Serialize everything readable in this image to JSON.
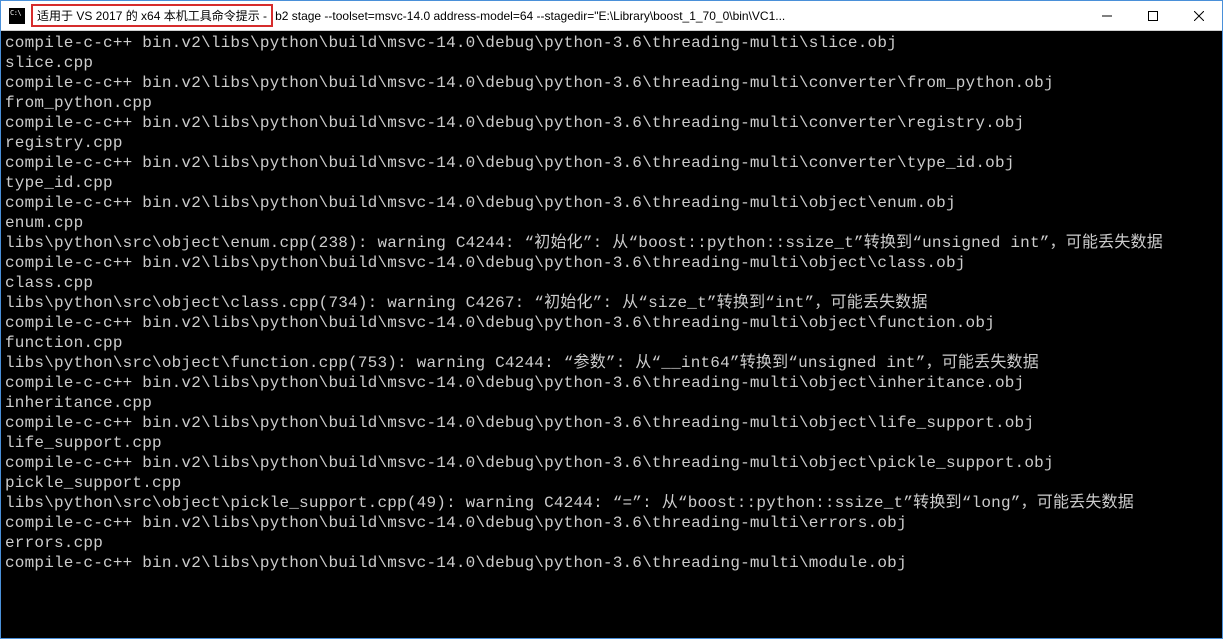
{
  "titlebar": {
    "highlighted": "适用于 VS 2017 的 x64 本机工具命令提示 -",
    "rest": " b2  stage --toolset=msvc-14.0 address-model=64 --stagedir=\"E:\\Library\\boost_1_70_0\\bin\\VC1..."
  },
  "controls": {
    "minimize": "minimize",
    "maximize": "maximize",
    "close": "close"
  },
  "console": {
    "lines": [
      "compile-c-c++ bin.v2\\libs\\python\\build\\msvc-14.0\\debug\\python-3.6\\threading-multi\\slice.obj",
      "slice.cpp",
      "compile-c-c++ bin.v2\\libs\\python\\build\\msvc-14.0\\debug\\python-3.6\\threading-multi\\converter\\from_python.obj",
      "from_python.cpp",
      "compile-c-c++ bin.v2\\libs\\python\\build\\msvc-14.0\\debug\\python-3.6\\threading-multi\\converter\\registry.obj",
      "registry.cpp",
      "compile-c-c++ bin.v2\\libs\\python\\build\\msvc-14.0\\debug\\python-3.6\\threading-multi\\converter\\type_id.obj",
      "type_id.cpp",
      "compile-c-c++ bin.v2\\libs\\python\\build\\msvc-14.0\\debug\\python-3.6\\threading-multi\\object\\enum.obj",
      "enum.cpp",
      "libs\\python\\src\\object\\enum.cpp(238): warning C4244: “初始化”: 从“boost::python::ssize_t”转换到“unsigned int”，可能丢失数据",
      "compile-c-c++ bin.v2\\libs\\python\\build\\msvc-14.0\\debug\\python-3.6\\threading-multi\\object\\class.obj",
      "class.cpp",
      "libs\\python\\src\\object\\class.cpp(734): warning C4267: “初始化”: 从“size_t”转换到“int”，可能丢失数据",
      "compile-c-c++ bin.v2\\libs\\python\\build\\msvc-14.0\\debug\\python-3.6\\threading-multi\\object\\function.obj",
      "function.cpp",
      "libs\\python\\src\\object\\function.cpp(753): warning C4244: “参数”: 从“__int64”转换到“unsigned int”，可能丢失数据",
      "compile-c-c++ bin.v2\\libs\\python\\build\\msvc-14.0\\debug\\python-3.6\\threading-multi\\object\\inheritance.obj",
      "inheritance.cpp",
      "compile-c-c++ bin.v2\\libs\\python\\build\\msvc-14.0\\debug\\python-3.6\\threading-multi\\object\\life_support.obj",
      "life_support.cpp",
      "compile-c-c++ bin.v2\\libs\\python\\build\\msvc-14.0\\debug\\python-3.6\\threading-multi\\object\\pickle_support.obj",
      "pickle_support.cpp",
      "libs\\python\\src\\object\\pickle_support.cpp(49): warning C4244: “=”: 从“boost::python::ssize_t”转换到“long”，可能丢失数据",
      "compile-c-c++ bin.v2\\libs\\python\\build\\msvc-14.0\\debug\\python-3.6\\threading-multi\\errors.obj",
      "errors.cpp",
      "compile-c-c++ bin.v2\\libs\\python\\build\\msvc-14.0\\debug\\python-3.6\\threading-multi\\module.obj"
    ]
  }
}
